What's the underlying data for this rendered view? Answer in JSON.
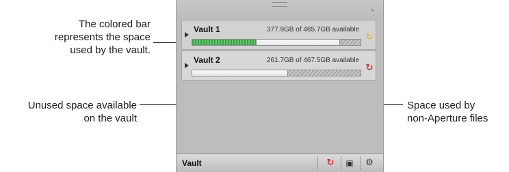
{
  "callouts": {
    "colored_bar": [
      "The colored bar",
      "represents the space",
      "used by the vault."
    ],
    "unused_space": [
      "Unused space available",
      "on the vault"
    ],
    "non_aperture": [
      "Space used by",
      "non-Aperture files"
    ]
  },
  "vaults": [
    {
      "name": "Vault 1",
      "space": "377.9GB of 465.7GB available",
      "used_fraction": 0.38,
      "unused_fraction": 0.5,
      "other_fraction": 0.12,
      "status_color": "#e0b64a",
      "status_icon": "sync-icon"
    },
    {
      "name": "Vault 2",
      "space": "261.7GB of 467.5GB available",
      "used_fraction": 0.0,
      "unused_fraction": 0.57,
      "other_fraction": 0.43,
      "status_color": "#c9322b",
      "status_icon": "sync-icon"
    }
  ],
  "footer": {
    "label": "Vault",
    "buttons": [
      "update-icon",
      "archive-icon",
      "gear-menu-icon"
    ]
  },
  "colors": {
    "used": "#4db35a",
    "other": "#b3b3b3",
    "panel": "#bdbdbd"
  }
}
